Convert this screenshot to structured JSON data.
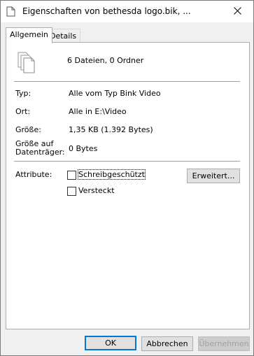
{
  "window": {
    "title": "Eigenschaften von bethesda logo.bik, ..."
  },
  "tabs": [
    {
      "label": "Allgemein",
      "active": true
    },
    {
      "label": "Details",
      "active": false
    }
  ],
  "general": {
    "summary": "6 Dateien, 0 Ordner",
    "type_label": "Typ:",
    "type_value": "Alle vom Typ Bink Video",
    "location_label": "Ort:",
    "location_value": "Alle in E:\\Video",
    "size_label": "Größe:",
    "size_value": "1,35 KB (1.392 Bytes)",
    "disk_size_label_line1": "Größe auf",
    "disk_size_label_line2": "Datenträger:",
    "disk_size_value": "0 Bytes",
    "attributes_label": "Attribute:",
    "readonly_label": "Schreibgeschützt",
    "hidden_label": "Versteckt",
    "advanced_button": "Erweitert...",
    "readonly_checked": false,
    "hidden_checked": false
  },
  "footer": {
    "ok": "OK",
    "cancel": "Abbrechen",
    "apply": "Übernehmen"
  }
}
